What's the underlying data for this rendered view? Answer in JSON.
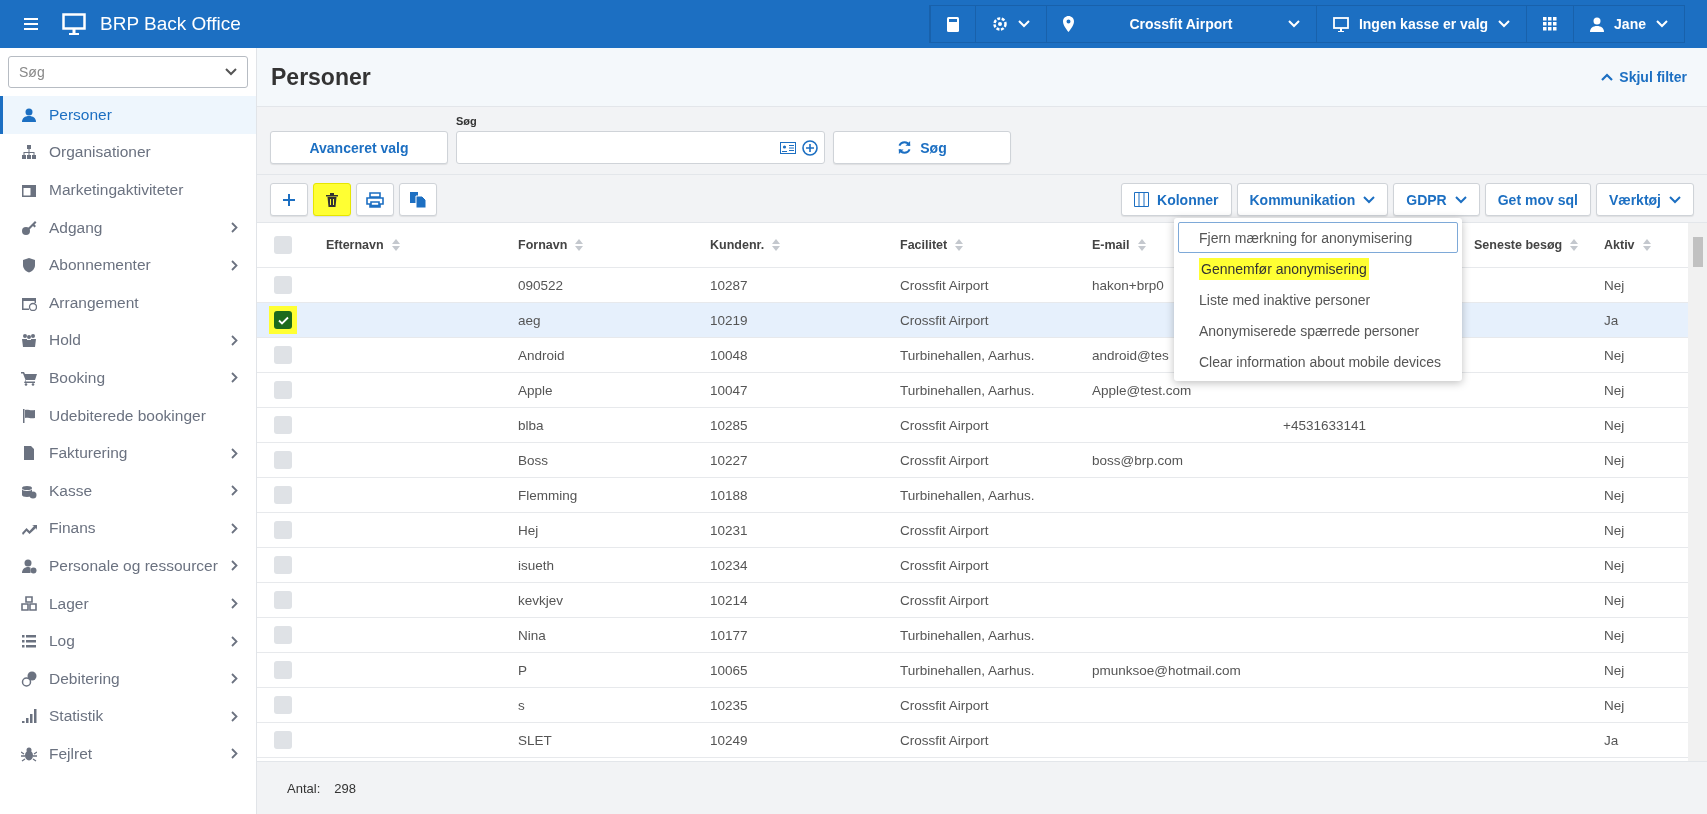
{
  "top_bar": {
    "app_title": "BRP Back Office",
    "items": [
      {
        "kind": "calculator",
        "dropdown": false
      },
      {
        "kind": "settings",
        "dropdown": true
      },
      {
        "kind": "location",
        "label": "Crossfit Airport",
        "dropdown": true
      },
      {
        "kind": "register",
        "label": "Ingen kasse er valg",
        "dropdown": true
      },
      {
        "kind": "apps",
        "dropdown": false
      },
      {
        "kind": "user",
        "label": "Jane",
        "dropdown": true
      }
    ]
  },
  "sidebar": {
    "search": {
      "placeholder": "Søg"
    },
    "items": [
      {
        "label": "Personer",
        "selected": true,
        "submenu": false
      },
      {
        "label": "Organisationer",
        "selected": false,
        "submenu": false
      },
      {
        "label": "Marketingaktiviteter",
        "selected": false,
        "submenu": false
      },
      {
        "label": "Adgang",
        "selected": false,
        "submenu": true
      },
      {
        "label": "Abonnementer",
        "selected": false,
        "submenu": true
      },
      {
        "label": "Arrangement",
        "selected": false,
        "submenu": false
      },
      {
        "label": "Hold",
        "selected": false,
        "submenu": true
      },
      {
        "label": "Booking",
        "selected": false,
        "submenu": true
      },
      {
        "label": "Udebiterede bookinger",
        "selected": false,
        "submenu": false
      },
      {
        "label": "Fakturering",
        "selected": false,
        "submenu": true
      },
      {
        "label": "Kasse",
        "selected": false,
        "submenu": true
      },
      {
        "label": "Finans",
        "selected": false,
        "submenu": true
      },
      {
        "label": "Personale og ressourcer",
        "selected": false,
        "submenu": true
      },
      {
        "label": "Lager",
        "selected": false,
        "submenu": true
      },
      {
        "label": "Log",
        "selected": false,
        "submenu": true
      },
      {
        "label": "Debitering",
        "selected": false,
        "submenu": true
      },
      {
        "label": "Statistik",
        "selected": false,
        "submenu": true
      },
      {
        "label": "Fejlret",
        "selected": false,
        "submenu": true
      }
    ]
  },
  "page": {
    "title": "Personer",
    "toggle_filter": "Skjul filter"
  },
  "filter": {
    "advanced_button": "Avanceret valg",
    "search_label": "Søg",
    "search_button": "Søg"
  },
  "toolbar": {
    "icon_buttons": [
      {
        "kind": "add",
        "highlighted": false
      },
      {
        "kind": "delete",
        "highlighted": true
      },
      {
        "kind": "print",
        "highlighted": false
      },
      {
        "kind": "copy",
        "highlighted": false
      }
    ],
    "buttons": [
      {
        "kind": "columns",
        "label": "Kolonner"
      },
      {
        "kind": "dropdown",
        "label": "Kommunikation"
      },
      {
        "kind": "dropdown",
        "label": "GDPR"
      },
      {
        "kind": "plain",
        "label": "Get mov sql"
      },
      {
        "kind": "dropdown",
        "label": "Værktøj"
      }
    ]
  },
  "dropdown_menu": [
    {
      "label": "Fjern mærkning for anonymisering",
      "focused": true,
      "highlighted": false
    },
    {
      "label": "Gennemfør anonymisering",
      "focused": false,
      "highlighted": true
    },
    {
      "label": "Liste med inaktive personer",
      "focused": false,
      "highlighted": false
    },
    {
      "label": "Anonymiserede spærrede personer",
      "focused": false,
      "highlighted": false
    },
    {
      "label": "Clear information about mobile devices",
      "focused": false,
      "highlighted": false
    }
  ],
  "table": {
    "select_all_checked": false,
    "columns": [
      {
        "label": "Efternavn"
      },
      {
        "label": "Fornavn"
      },
      {
        "label": "Kundenr."
      },
      {
        "label": "Facilitet"
      },
      {
        "label": "E-mail"
      },
      {},
      {
        "label": "Seneste besøg"
      },
      {
        "label": "Aktiv"
      }
    ],
    "rows": [
      {
        "fornavn": "090522",
        "kundenr": "10287",
        "facilitet": "Crossfit Airport",
        "email": "hakon+brp0",
        "aktiv": "Nej",
        "selected": false
      },
      {
        "fornavn": "aeg",
        "kundenr": "10219",
        "facilitet": "Crossfit Airport",
        "aktiv": "Ja",
        "selected": true
      },
      {
        "fornavn": "Android",
        "kundenr": "10048",
        "facilitet": "Turbinehallen, Aarhus.",
        "email": "android@tes",
        "aktiv": "Nej",
        "selected": false
      },
      {
        "fornavn": "Apple",
        "kundenr": "10047",
        "facilitet": "Turbinehallen, Aarhus.",
        "email": "Apple@test.com",
        "aktiv": "Nej",
        "selected": false
      },
      {
        "fornavn": "blba",
        "kundenr": "10285",
        "facilitet": "Crossfit Airport",
        "column_6": "+4531633141",
        "aktiv": "Nej",
        "selected": false
      },
      {
        "fornavn": "Boss",
        "kundenr": "10227",
        "facilitet": "Crossfit Airport",
        "email": "boss@brp.com",
        "aktiv": "Nej",
        "selected": false
      },
      {
        "fornavn": "Flemming",
        "kundenr": "10188",
        "facilitet": "Turbinehallen, Aarhus.",
        "aktiv": "Nej",
        "selected": false
      },
      {
        "fornavn": "Hej",
        "kundenr": "10231",
        "facilitet": "Crossfit Airport",
        "aktiv": "Nej",
        "selected": false
      },
      {
        "fornavn": "isueth",
        "kundenr": "10234",
        "facilitet": "Crossfit Airport",
        "aktiv": "Nej",
        "selected": false
      },
      {
        "fornavn": "kevkjev",
        "kundenr": "10214",
        "facilitet": "Crossfit Airport",
        "aktiv": "Nej",
        "selected": false
      },
      {
        "fornavn": "Nina",
        "kundenr": "10177",
        "facilitet": "Turbinehallen, Aarhus.",
        "aktiv": "Nej",
        "selected": false
      },
      {
        "fornavn": "P",
        "kundenr": "10065",
        "facilitet": "Turbinehallen, Aarhus.",
        "email": "pmunksoe@hotmail.com",
        "aktiv": "Nej",
        "selected": false
      },
      {
        "fornavn": "s",
        "kundenr": "10235",
        "facilitet": "Crossfit Airport",
        "aktiv": "Nej",
        "selected": false
      },
      {
        "fornavn": "SLET",
        "kundenr": "10249",
        "facilitet": "Crossfit Airport",
        "aktiv": "Ja",
        "selected": false
      }
    ]
  },
  "footer": {
    "count_label": "Antal:",
    "count": "298"
  }
}
